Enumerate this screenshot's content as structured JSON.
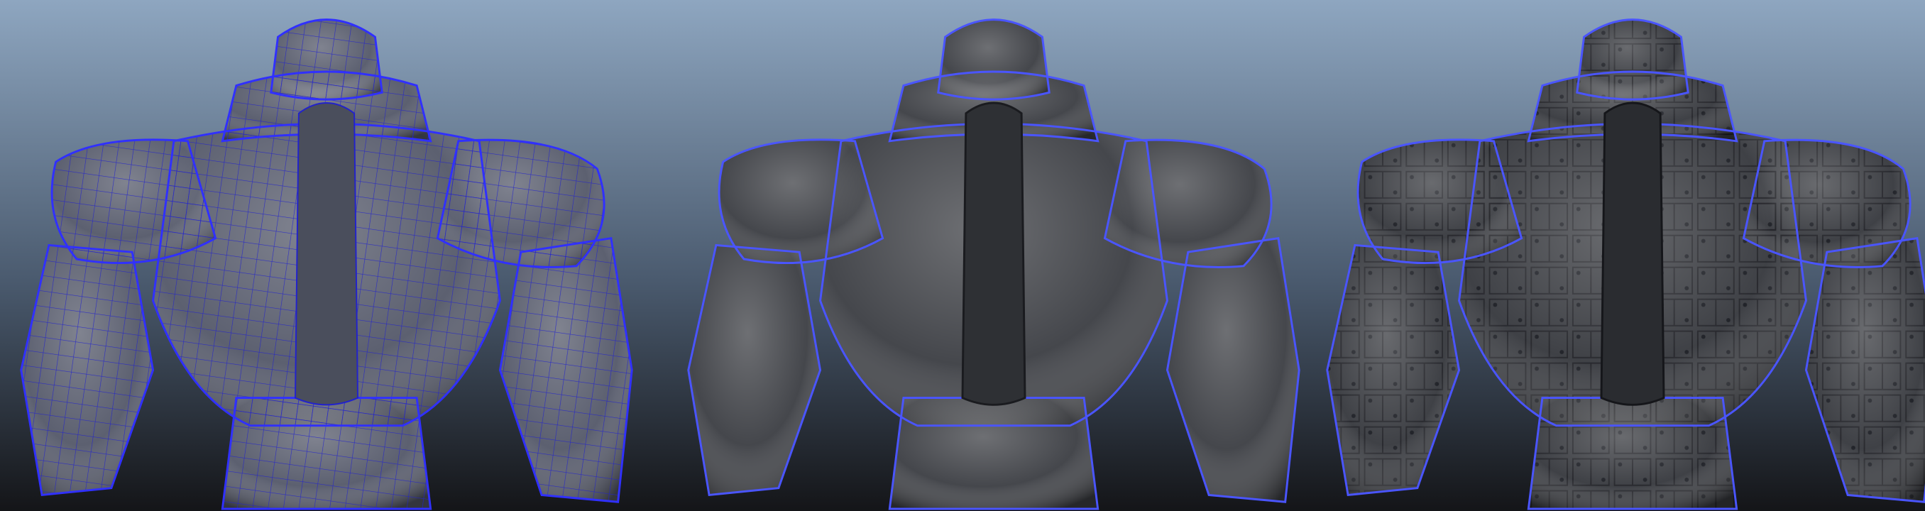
{
  "scene": {
    "background": {
      "top_color": "#8ea6c0",
      "mid_color": "#4a5a6e",
      "bottom_color": "#141518"
    },
    "figures": [
      {
        "id": "figure-wireframe",
        "render_mode": "wireframe-overlay",
        "base_color": "#5c6070",
        "wire_color": "#1f1fc8",
        "rim_color": "#3030ff"
      },
      {
        "id": "figure-smooth",
        "render_mode": "smooth-shaded",
        "base_color": "#45474c",
        "rim_color": "#4a55ff"
      },
      {
        "id": "figure-detailed",
        "render_mode": "detailed-shaded",
        "base_color": "#3f4146",
        "rim_color": "#4a55ff"
      }
    ]
  }
}
